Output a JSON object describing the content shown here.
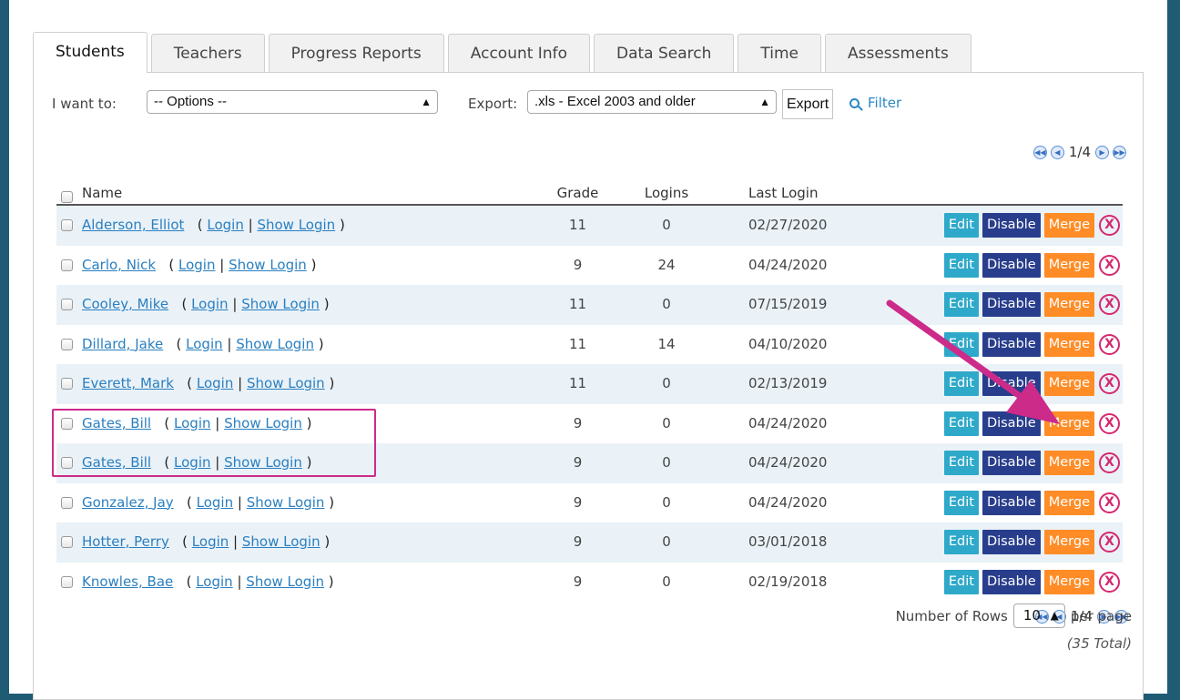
{
  "tabs": [
    "Students",
    "Teachers",
    "Progress Reports",
    "Account Info",
    "Data Search",
    "Time",
    "Assessments"
  ],
  "toolbar": {
    "i_want_to_label": "I want to:",
    "options_value": "-- Options --",
    "export_label": "Export:",
    "export_format": ".xls - Excel 2003 and older",
    "export_button": "Export",
    "filter_label": "Filter"
  },
  "pager": {
    "current": "1/4"
  },
  "table": {
    "headers": {
      "name": "Name",
      "grade": "Grade",
      "logins": "Logins",
      "last_login": "Last Login"
    },
    "action_labels": {
      "edit": "Edit",
      "disable": "Disable",
      "merge": "Merge",
      "delete": "X"
    },
    "link_labels": {
      "login": "Login",
      "show_login": "Show Login",
      "open": "(",
      "sep": "|",
      "close": ")"
    },
    "rows": [
      {
        "name": "Alderson, Elliot",
        "grade": "11",
        "logins": "0",
        "last_login": "02/27/2020"
      },
      {
        "name": "Carlo, Nick",
        "grade": "9",
        "logins": "24",
        "last_login": "04/24/2020"
      },
      {
        "name": "Cooley, Mike",
        "grade": "11",
        "logins": "0",
        "last_login": "07/15/2019"
      },
      {
        "name": "Dillard, Jake",
        "grade": "11",
        "logins": "14",
        "last_login": "04/10/2020"
      },
      {
        "name": "Everett, Mark",
        "grade": "11",
        "logins": "0",
        "last_login": "02/13/2019"
      },
      {
        "name": "Gates, Bill",
        "grade": "9",
        "logins": "0",
        "last_login": "04/24/2020"
      },
      {
        "name": "Gates, Bill",
        "grade": "9",
        "logins": "0",
        "last_login": "04/24/2020"
      },
      {
        "name": "Gonzalez, Jay",
        "grade": "9",
        "logins": "0",
        "last_login": "04/24/2020"
      },
      {
        "name": "Hotter, Perry",
        "grade": "9",
        "logins": "0",
        "last_login": "03/01/2018"
      },
      {
        "name": "Knowles, Bae",
        "grade": "9",
        "logins": "0",
        "last_login": "02/19/2018"
      }
    ]
  },
  "footer": {
    "rows_label": "Number of Rows",
    "rows_value": "10",
    "per_page": "per page",
    "total": "(35 Total)"
  },
  "colors": {
    "accent_link": "#2a7fc0",
    "edit": "#2fa9c9",
    "disable": "#283d8c",
    "merge": "#ff8c26",
    "delete": "#d5286e",
    "annotation": "#cc2b8a"
  },
  "icons": {
    "first": "first-page-icon",
    "prev": "prev-page-icon",
    "next": "next-page-icon",
    "last": "last-page-icon",
    "filter": "search-icon",
    "delete": "delete-circle-icon"
  }
}
